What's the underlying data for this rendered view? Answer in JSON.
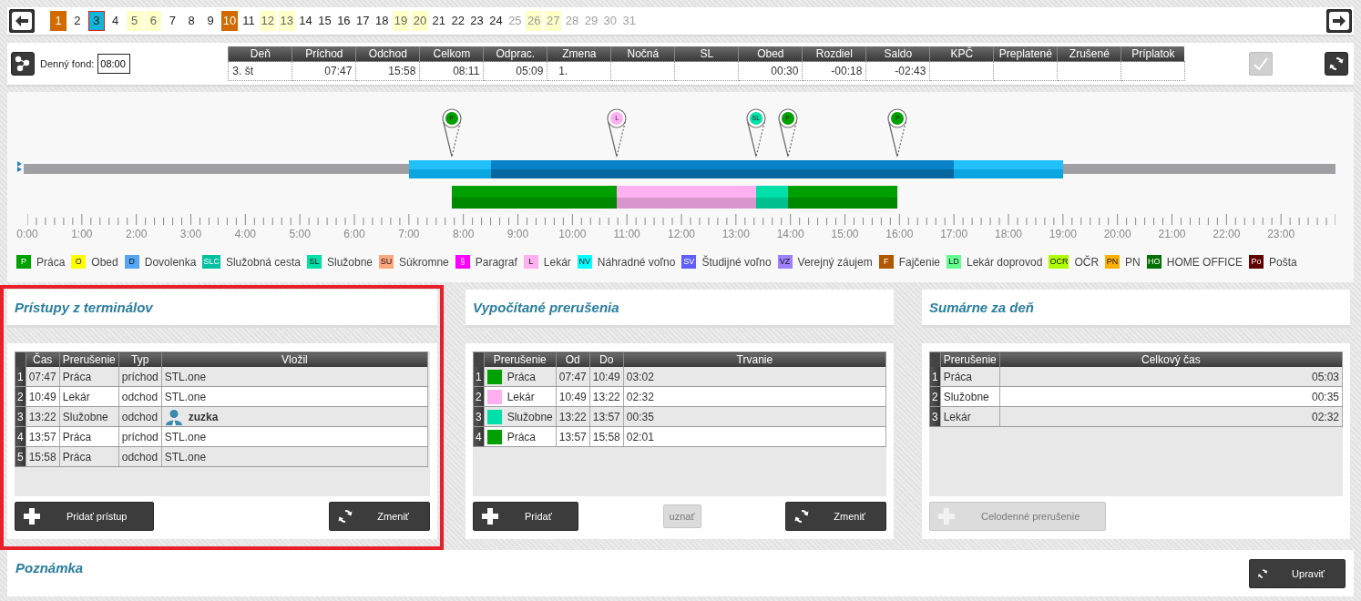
{
  "days_nav": {
    "days": [
      {
        "label": "1",
        "kind": "holiday",
        "selected": false
      },
      {
        "label": "2",
        "kind": "workday",
        "selected": false
      },
      {
        "label": "3",
        "kind": "workday",
        "selected": true
      },
      {
        "label": "4",
        "kind": "workday",
        "selected": false
      },
      {
        "label": "5",
        "kind": "weekend",
        "selected": false
      },
      {
        "label": "6",
        "kind": "weekend",
        "selected": false
      },
      {
        "label": "7",
        "kind": "workday",
        "selected": false
      },
      {
        "label": "8",
        "kind": "workday",
        "selected": false
      },
      {
        "label": "9",
        "kind": "workday",
        "selected": false
      },
      {
        "label": "10",
        "kind": "holiday",
        "selected": false
      },
      {
        "label": "11",
        "kind": "workday",
        "selected": false
      },
      {
        "label": "12",
        "kind": "weekend",
        "selected": false
      },
      {
        "label": "13",
        "kind": "weekend",
        "selected": false
      },
      {
        "label": "14",
        "kind": "workday",
        "selected": false
      },
      {
        "label": "15",
        "kind": "workday",
        "selected": false
      },
      {
        "label": "16",
        "kind": "workday",
        "selected": false
      },
      {
        "label": "17",
        "kind": "workday",
        "selected": false
      },
      {
        "label": "18",
        "kind": "workday",
        "selected": false
      },
      {
        "label": "19",
        "kind": "weekend",
        "selected": false
      },
      {
        "label": "20",
        "kind": "weekend",
        "selected": false
      },
      {
        "label": "21",
        "kind": "workday",
        "selected": false
      },
      {
        "label": "22",
        "kind": "workday",
        "selected": false
      },
      {
        "label": "23",
        "kind": "workday",
        "selected": false
      },
      {
        "label": "24",
        "kind": "workday",
        "selected": false
      },
      {
        "label": "25",
        "kind": "future",
        "selected": false
      },
      {
        "label": "26",
        "kind": "future-weekend",
        "selected": false
      },
      {
        "label": "27",
        "kind": "future-weekend",
        "selected": false
      },
      {
        "label": "28",
        "kind": "future",
        "selected": false
      },
      {
        "label": "29",
        "kind": "future",
        "selected": false
      },
      {
        "label": "30",
        "kind": "future",
        "selected": false
      },
      {
        "label": "31",
        "kind": "future",
        "selected": false
      }
    ]
  },
  "day_summary": {
    "fund_label": "Denný fond:",
    "fund_value": "08:00",
    "confirm_disabled": true,
    "columns": [
      {
        "label": "Deň",
        "value": "3. št",
        "kind": "text"
      },
      {
        "label": "Príchod",
        "value": "07:47",
        "kind": "time"
      },
      {
        "label": "Odchod",
        "value": "15:58",
        "kind": "time"
      },
      {
        "label": "Celkom",
        "value": "08:11",
        "kind": "time"
      },
      {
        "label": "Odprac.",
        "value": "05:09",
        "kind": "time"
      },
      {
        "label": "Zmena",
        "value": "1.",
        "kind": "shift"
      },
      {
        "label": "Nočná",
        "kind": "time"
      },
      {
        "label": "SL",
        "kind": "time"
      },
      {
        "label": "Obed",
        "value": "00:30",
        "kind": "time"
      },
      {
        "label": "Rozdiel",
        "value": "-00:18",
        "kind": "time"
      },
      {
        "label": "Saldo",
        "value": "-02:43",
        "kind": "time"
      },
      {
        "label": "KPČ",
        "kind": "time"
      },
      {
        "label": "Preplatené",
        "kind": "time"
      },
      {
        "label": "Zrušené",
        "kind": "time"
      },
      {
        "label": "Príplatok",
        "kind": "time"
      }
    ]
  },
  "timeline": {
    "bands": [
      {
        "kind": "outer"
      },
      {
        "kind": "core"
      }
    ],
    "markers": [
      {
        "code": "P",
        "color": "#00a000"
      },
      {
        "code": "L",
        "color": "#ffb0f0"
      },
      {
        "code": "SL",
        "color": "#00e0a8"
      },
      {
        "code": "P",
        "color": "#00a000"
      },
      {
        "code": "P",
        "color": "#00a000"
      }
    ],
    "axis_labels": [
      "0:00",
      "1:00",
      "2:00",
      "3:00",
      "4:00",
      "5:00",
      "6:00",
      "7:00",
      "8:00",
      "9:00",
      "10:00",
      "11:00",
      "12:00",
      "13:00",
      "14:00",
      "15:00",
      "16:00",
      "17:00",
      "18:00",
      "19:00",
      "20:00",
      "21:00",
      "22:00",
      "23:00"
    ],
    "legend": [
      {
        "code": "P",
        "label": "Práca",
        "color": "#00a000"
      },
      {
        "code": "O",
        "label": "Obed",
        "color": "#ffff00"
      },
      {
        "code": "D",
        "label": "Dovolenka",
        "color": "#55a5f5"
      },
      {
        "code": "SLC",
        "label": "Služobná cesta",
        "color": "#00c0a0"
      },
      {
        "code": "SL",
        "label": "Služobne",
        "color": "#00e0a8"
      },
      {
        "code": "SU",
        "label": "Súkromne",
        "color": "#ffa880"
      },
      {
        "code": "§",
        "label": "Paragraf",
        "color": "#ff00ff"
      },
      {
        "code": "L",
        "label": "Lekár",
        "color": "#ffb0f0"
      },
      {
        "code": "NV",
        "label": "Náhradné voľno",
        "color": "#00ffff"
      },
      {
        "code": "SV",
        "label": "Študijné voľno",
        "color": "#6060ff"
      },
      {
        "code": "VZ",
        "label": "Verejný záujem",
        "color": "#a080ff"
      },
      {
        "code": "F",
        "label": "Fajčenie",
        "color": "#b05800"
      },
      {
        "code": "LD",
        "label": "Lekár doprovod",
        "color": "#60ff90"
      },
      {
        "code": "OCR",
        "label": "OČR",
        "color": "#b0ff00"
      },
      {
        "code": "PN",
        "label": "PN",
        "color": "#ffb000"
      },
      {
        "code": "HO",
        "label": "HOME OFFICE",
        "color": "#007000"
      },
      {
        "code": "Po",
        "label": "Pošta",
        "color": "#600000"
      }
    ]
  },
  "panels": [
    {
      "title": "Prístupy z terminálov",
      "highlighted": true,
      "table": {
        "columns": [
          {
            "label": "Čas",
            "kind": "text"
          },
          {
            "label": "Prerušenie",
            "kind": "text"
          },
          {
            "label": "Typ",
            "kind": "text"
          },
          {
            "label": "Vložil",
            "kind": "text"
          }
        ],
        "rows": [
          {
            "number": "1",
            "cells": [
              "07:47",
              "Práca",
              "príchod",
              "STL.one"
            ],
            "kind": "system"
          },
          {
            "number": "2",
            "cells": [
              "10:49",
              "Lekár",
              "odchod",
              "STL.one"
            ],
            "kind": "system"
          },
          {
            "number": "3",
            "cells": [
              "13:22",
              "Služobne",
              "odchod",
              "zuzka"
            ],
            "kind": "user"
          },
          {
            "number": "4",
            "cells": [
              "13:57",
              "Práca",
              "príchod",
              "STL.one"
            ],
            "kind": "system"
          },
          {
            "number": "5",
            "cells": [
              "15:58",
              "Práca",
              "odchod",
              "STL.one"
            ],
            "kind": "system"
          }
        ]
      },
      "buttons": [
        {
          "label": "Pridať prístup",
          "kind": "add",
          "disabled": false
        },
        {
          "label": "Zmeniť",
          "kind": "refresh",
          "disabled": false
        }
      ]
    },
    {
      "title": "Vypočítané prerušenia",
      "highlighted": false,
      "table": {
        "columns": [
          {
            "label": "Prerušenie",
            "kind": "text"
          },
          {
            "label": "Od",
            "kind": "text"
          },
          {
            "label": "Do",
            "kind": "text"
          },
          {
            "label": "Trvanie",
            "kind": "text"
          }
        ],
        "rows": [
          {
            "number": "1",
            "cells": [
              "Práca",
              "07:47",
              "10:49",
              "03:02"
            ],
            "color": "#00a000"
          },
          {
            "number": "2",
            "cells": [
              "Lekár",
              "10:49",
              "13:22",
              "02:32"
            ],
            "color": "#ffb0f0"
          },
          {
            "number": "3",
            "cells": [
              "Služobne",
              "13:22",
              "13:57",
              "00:35"
            ],
            "color": "#00e0a8"
          },
          {
            "number": "4",
            "cells": [
              "Práca",
              "13:57",
              "15:58",
              "02:01"
            ],
            "color": "#00a000"
          }
        ]
      },
      "buttons": [
        {
          "label": "Pridať",
          "kind": "add",
          "disabled": false
        },
        {
          "label": "uznať",
          "kind": "plain",
          "disabled": true
        },
        {
          "label": "Zmeniť",
          "kind": "refresh",
          "disabled": false
        }
      ]
    },
    {
      "title": "Sumárne za deň",
      "highlighted": false,
      "table": {
        "columns": [
          {
            "label": "Prerušenie",
            "kind": "text"
          },
          {
            "label": "Celkový čas",
            "kind": "duration"
          }
        ],
        "rows": [
          {
            "number": "1",
            "cells": [
              "Práca",
              "05:03"
            ]
          },
          {
            "number": "2",
            "cells": [
              "Služobne",
              "00:35"
            ]
          },
          {
            "number": "3",
            "cells": [
              "Lekár",
              "02:32"
            ]
          }
        ]
      },
      "buttons": [
        {
          "label": "Celodenné prerušenie",
          "kind": "add",
          "disabled": true
        }
      ]
    }
  ],
  "note": {
    "title": "Poznámka",
    "button": {
      "label": "Upraviť",
      "kind": "refresh",
      "disabled": false
    }
  }
}
